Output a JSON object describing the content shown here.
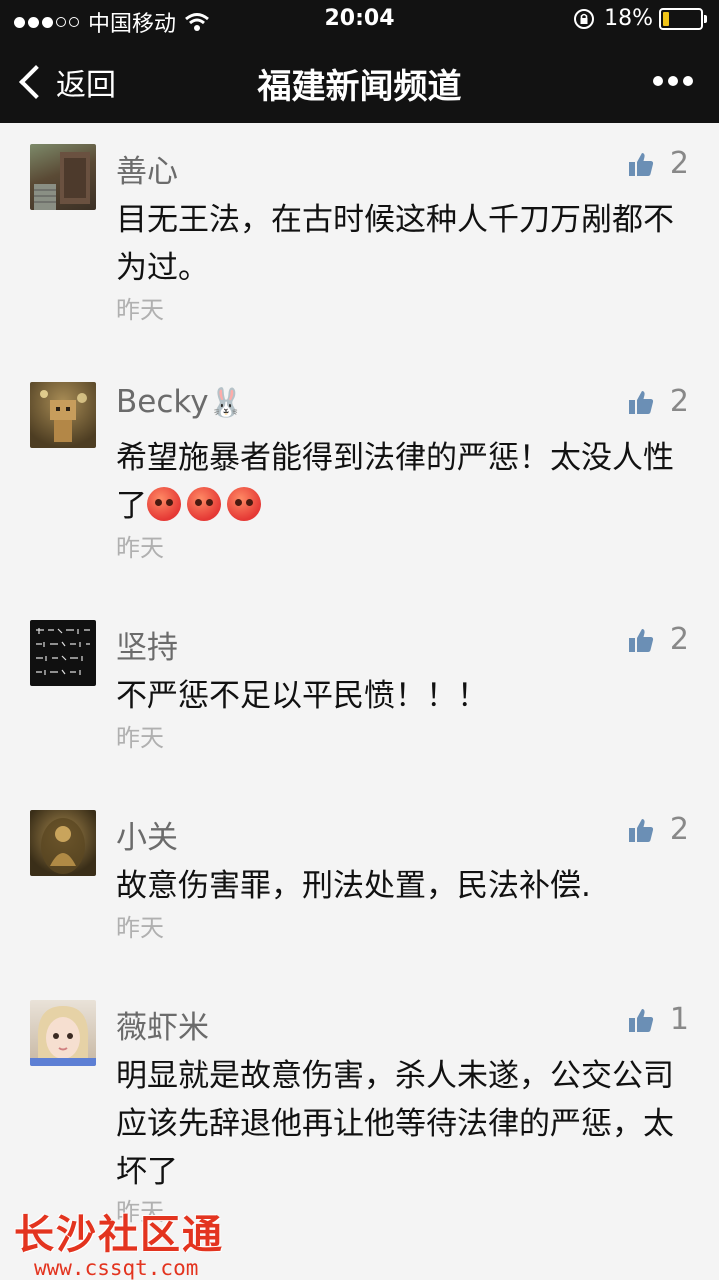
{
  "status_bar": {
    "carrier": "中国移动",
    "time": "20:04",
    "battery": "18%",
    "battery_level": 0.18,
    "signal_dots_filled": 3,
    "signal_dots_empty": 2,
    "icons": [
      "signal-dots-icon",
      "wifi-icon",
      "orientation-lock-icon",
      "battery-icon"
    ]
  },
  "nav": {
    "back_label": "返回",
    "title": "福建新闻频道",
    "more_icon": "more-dots-icon"
  },
  "comments": [
    {
      "username": "善心",
      "likes": "2",
      "content": "目无王法，在古时候这种人千刀万剐都不为过。",
      "timestamp": "昨天",
      "avatar": "wooden-door-photo"
    },
    {
      "username": "Becky",
      "username_emoji": "🐰",
      "likes": "2",
      "content": "希望施暴者能得到法律的严惩！太没人性了",
      "emoji_count": 3,
      "emoji_name": "angry-face-emoji",
      "timestamp": "昨天",
      "avatar": "cardboard-robot-photo"
    },
    {
      "username": "坚持",
      "likes": "2",
      "content": "不严惩不足以平民愤！！！",
      "timestamp": "昨天",
      "avatar": "handwritten-text-image"
    },
    {
      "username": "小关",
      "likes": "2",
      "content": "故意伤害罪，刑法处置，民法补偿.",
      "timestamp": "昨天",
      "avatar": "buddha-pendant-photo"
    },
    {
      "username": "薇虾米",
      "likes": "1",
      "content": "明显就是故意伤害，杀人未遂，公交公司应该先辞退他再让他等待法律的严惩，太坏了",
      "timestamp": "昨天",
      "avatar": "girl-portrait-photo"
    }
  ],
  "watermark": {
    "title": "长沙社区通",
    "url": "www.cssqt.com"
  },
  "colors": {
    "header_bg": "#121212",
    "page_bg": "#f4f4f4",
    "like_icon": "#6b8fb5",
    "battery_fill": "#f0c419",
    "watermark": "#e3341f"
  }
}
